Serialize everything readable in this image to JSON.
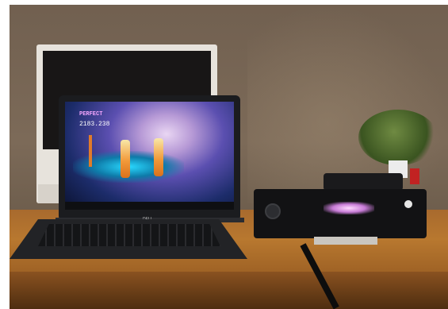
{
  "laptop_screen": {
    "game_label": "PERFECT",
    "score": "2183.238"
  },
  "laptop_brand": "DELL",
  "colors": {
    "wall": "#7c6a58",
    "desk": "#b8782f",
    "screen_glow": "#b79ad6",
    "kinect_light": "#c77bd6"
  }
}
